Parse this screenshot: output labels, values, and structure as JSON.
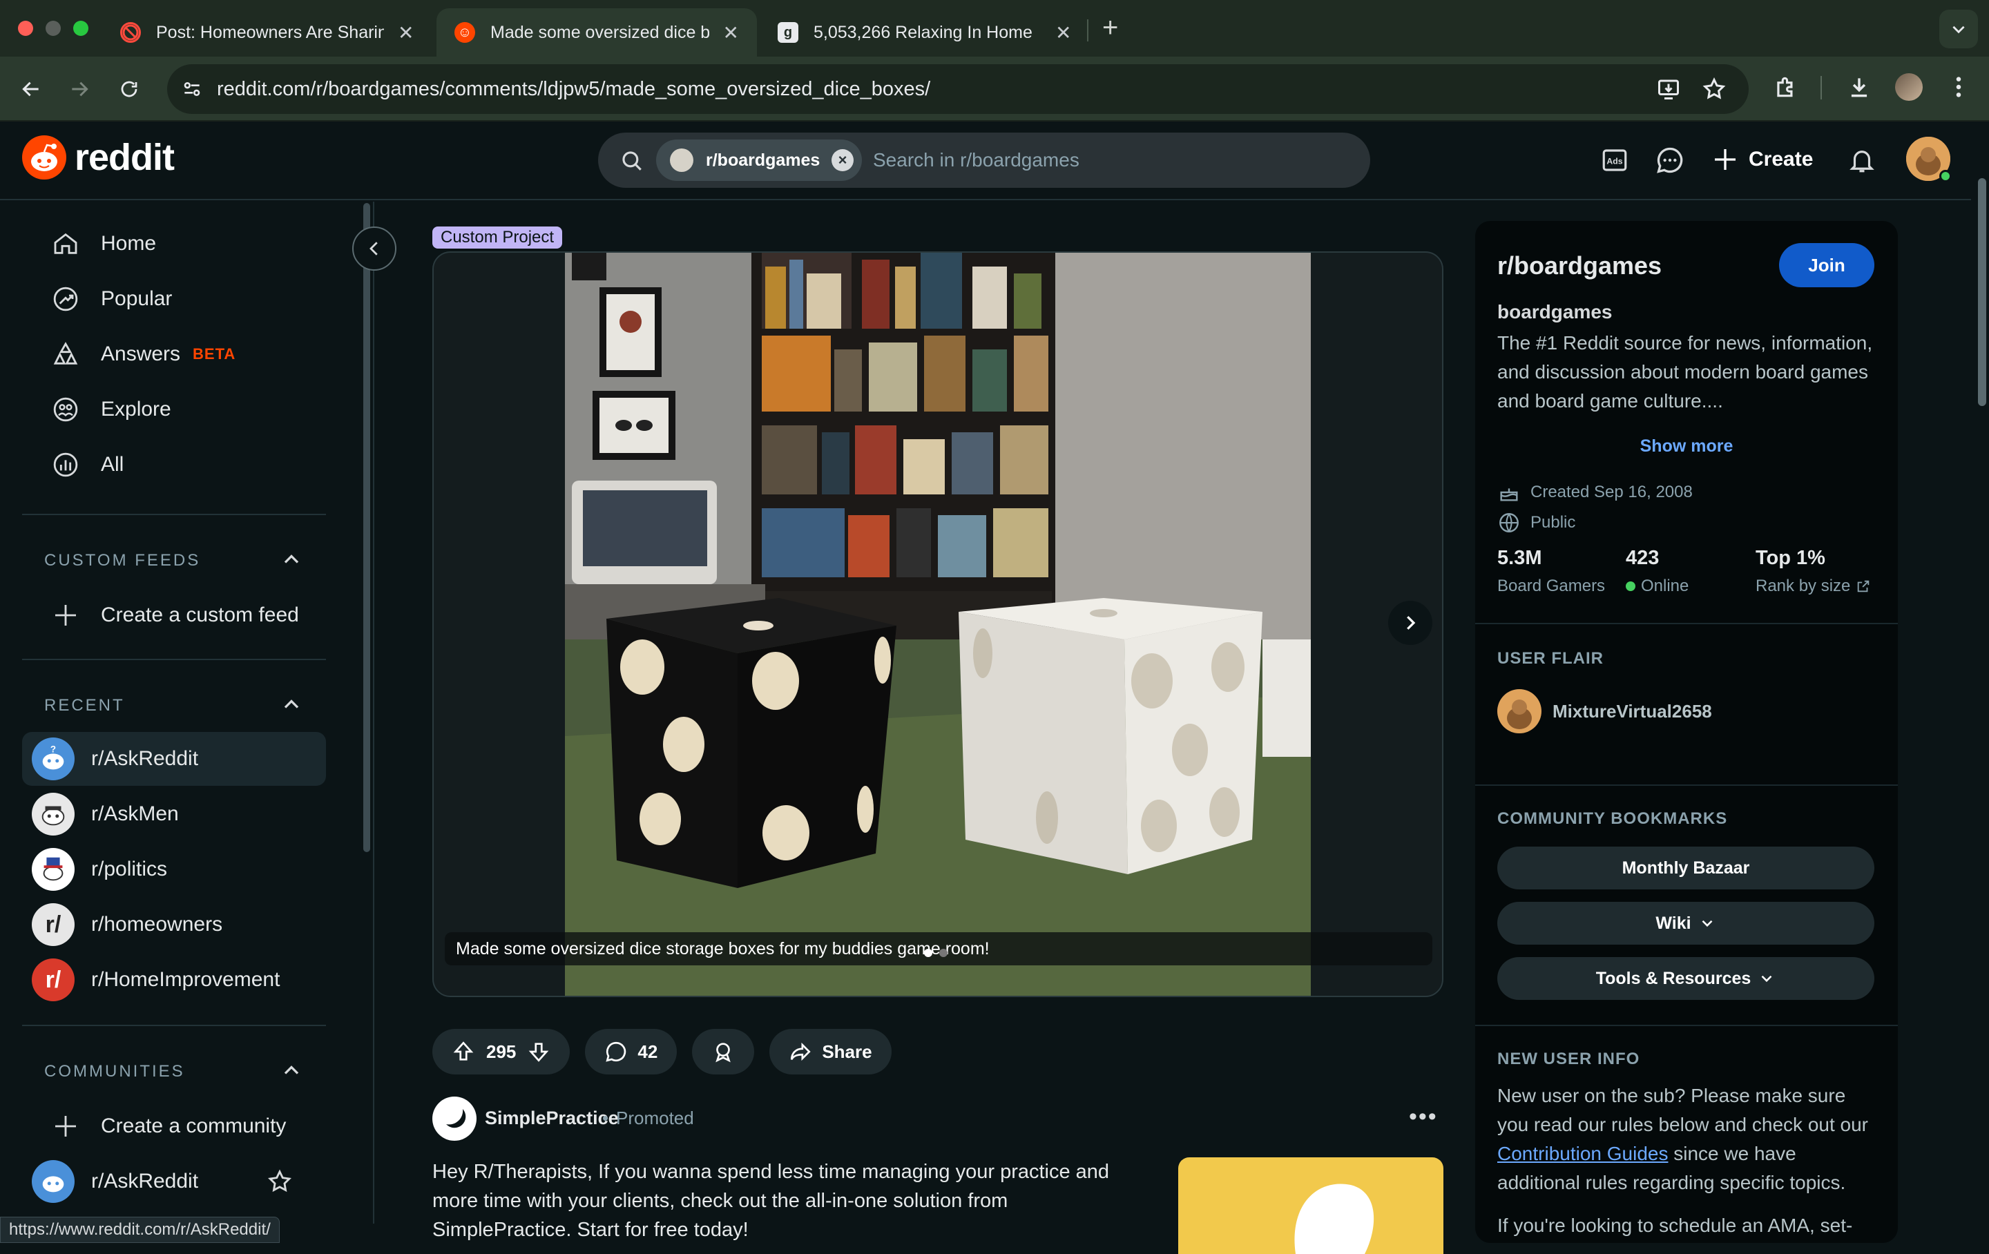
{
  "browser": {
    "tabs": [
      {
        "title": "Post: Homeowners Are Sharin",
        "active": false
      },
      {
        "title": "Made some oversized dice bo",
        "active": true
      },
      {
        "title": "5,053,266 Relaxing In Home",
        "active": false
      }
    ],
    "url": "reddit.com/r/boardgames/comments/ldjpw5/made_some_oversized_dice_boxes/",
    "status_url": "https://www.reddit.com/r/AskReddit/"
  },
  "header": {
    "logo_text": "reddit",
    "search_chip": "r/boardgames",
    "search_placeholder": "Search in r/boardgames",
    "create_label": "Create"
  },
  "sidebar": {
    "nav": [
      {
        "label": "Home",
        "icon": "home-icon"
      },
      {
        "label": "Popular",
        "icon": "popular-icon"
      },
      {
        "label": "Answers",
        "icon": "answers-icon",
        "badge": "BETA"
      },
      {
        "label": "Explore",
        "icon": "explore-icon"
      },
      {
        "label": "All",
        "icon": "all-icon"
      }
    ],
    "custom_feeds_heading": "CUSTOM FEEDS",
    "create_custom_feed": "Create a custom feed",
    "recent_heading": "RECENT",
    "recent": [
      {
        "name": "r/AskReddit"
      },
      {
        "name": "r/AskMen"
      },
      {
        "name": "r/politics"
      },
      {
        "name": "r/homeowners"
      },
      {
        "name": "r/HomeImprovement"
      }
    ],
    "communities_heading": "COMMUNITIES",
    "create_community": "Create a community",
    "communities": [
      {
        "name": "r/AskReddit"
      }
    ]
  },
  "post": {
    "flair": "Custom Project",
    "caption": "Made some oversized dice storage boxes for my buddies game room!",
    "votes": "295",
    "comments": "42",
    "share_label": "Share"
  },
  "promo": {
    "name": "SimplePractice",
    "separator": "•",
    "tag": "Promoted",
    "body": "Hey R/Therapists, If you wanna spend less time managing your practice and more time with your clients, check out the all-in-one solution from SimplePractice. Start for free today!"
  },
  "community": {
    "title": "r/boardgames",
    "join_label": "Join",
    "name": "boardgames",
    "description": "The #1 Reddit source for news, information, and discussion about modern board games and board game culture....",
    "show_more": "Show more",
    "created": "Created Sep 16, 2008",
    "visibility": "Public",
    "stats": [
      {
        "value": "5.3M",
        "label": "Board Gamers"
      },
      {
        "value": "423",
        "label": "Online"
      },
      {
        "value": "Top 1%",
        "label": "Rank by size"
      }
    ],
    "user_flair_heading": "USER FLAIR",
    "user_name": "MixtureVirtual2658",
    "bookmarks_heading": "COMMUNITY BOOKMARKS",
    "bookmarks": [
      "Monthly Bazaar",
      "Wiki",
      "Tools & Resources"
    ],
    "new_user_heading": "NEW USER INFO",
    "new_user_pre": "New user on the sub? Please make sure you read our rules below and check out our ",
    "new_user_link": "Contribution Guides",
    "new_user_post": " since we have additional rules regarding specific topics.",
    "new_user_more": "If you're looking to schedule an AMA, set-"
  },
  "colors": {
    "accent": "#ff4500",
    "join": "#115bca",
    "link": "#6ca9ff",
    "flair": "#c1b5f6"
  }
}
